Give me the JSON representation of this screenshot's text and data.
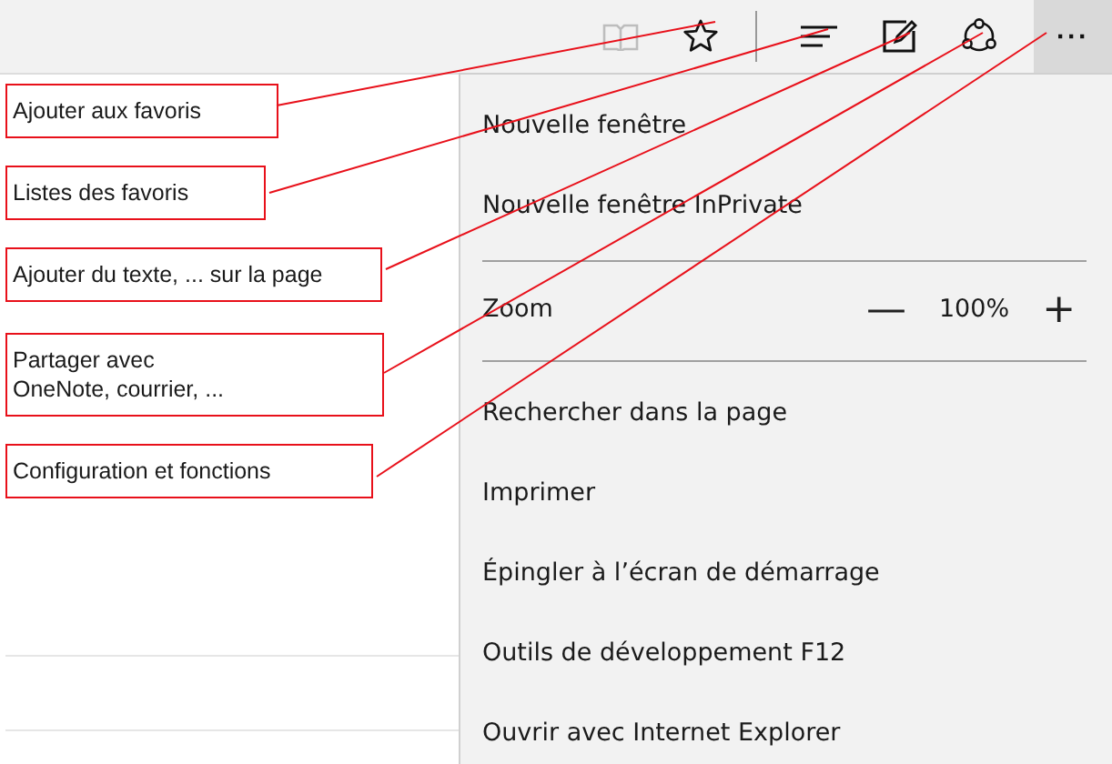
{
  "toolbar": {
    "buttons": [
      {
        "kind": "reading",
        "disabled": true,
        "selected": false
      },
      {
        "kind": "favorite",
        "disabled": false,
        "selected": false
      },
      {
        "kind": "separator"
      },
      {
        "kind": "hub",
        "disabled": false,
        "selected": false
      },
      {
        "kind": "note",
        "disabled": false,
        "selected": false
      },
      {
        "kind": "share",
        "disabled": false,
        "selected": false
      },
      {
        "kind": "more",
        "label": "···",
        "disabled": false,
        "selected": true
      }
    ]
  },
  "callouts": [
    {
      "lines": [
        "Ajouter aux favoris"
      ]
    },
    {
      "lines": [
        "Listes des favoris"
      ]
    },
    {
      "lines": [
        "Ajouter du texte, ... sur la page"
      ]
    },
    {
      "lines": [
        "Partager avec",
        "OneNote, courrier, ..."
      ]
    },
    {
      "lines": [
        "Configuration et fonctions"
      ]
    }
  ],
  "menu": {
    "items": [
      {
        "kind": "item",
        "label": "Nouvelle fenêtre"
      },
      {
        "kind": "item",
        "label": "Nouvelle fenêtre InPrivate"
      },
      {
        "kind": "divider"
      },
      {
        "kind": "zoom",
        "label": "Zoom",
        "minus": "—",
        "value": "100%",
        "plus": "+"
      },
      {
        "kind": "divider"
      },
      {
        "kind": "item",
        "label": "Rechercher dans la page"
      },
      {
        "kind": "item",
        "label": "Imprimer"
      },
      {
        "kind": "item",
        "label": "Épingler à l’écran de démarrage"
      },
      {
        "kind": "item",
        "label": "Outils de développement F12"
      },
      {
        "kind": "item",
        "label": "Ouvrir avec Internet Explorer"
      }
    ]
  }
}
